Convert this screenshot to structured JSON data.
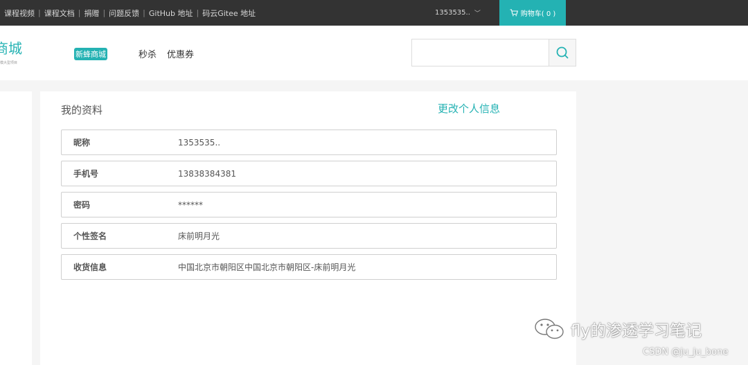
{
  "topbar": {
    "links": [
      "课程视频",
      "课程文档",
      "捐赠",
      "问题反馈",
      "GitHub 地址",
      "码云Gitee 地址"
    ],
    "username": "1353535..",
    "cart_label": "购物车( 0 )"
  },
  "header": {
    "logo_text": "商城",
    "logo_subtitle": "模大型项目",
    "brand_badge": "新蜂商城",
    "nav": [
      "秒杀",
      "优惠券"
    ],
    "search_value": ""
  },
  "profile": {
    "title": "我的资料",
    "edit_link": "更改个人信息",
    "rows": [
      {
        "label": "昵称",
        "value": "1353535.."
      },
      {
        "label": "手机号",
        "value": "13838384381"
      },
      {
        "label": "密码",
        "value": "******"
      },
      {
        "label": "个性签名",
        "value": "床前明月光"
      },
      {
        "label": "收货信息",
        "value": "中国北京市朝阳区中国北京市朝阳区-床前明月光"
      }
    ]
  },
  "watermark": {
    "text": "fly的渗透学习笔记",
    "csdn": "CSDN @ju_ju_bone"
  },
  "colors": {
    "accent": "#24b2b3",
    "topbar": "#333333"
  }
}
